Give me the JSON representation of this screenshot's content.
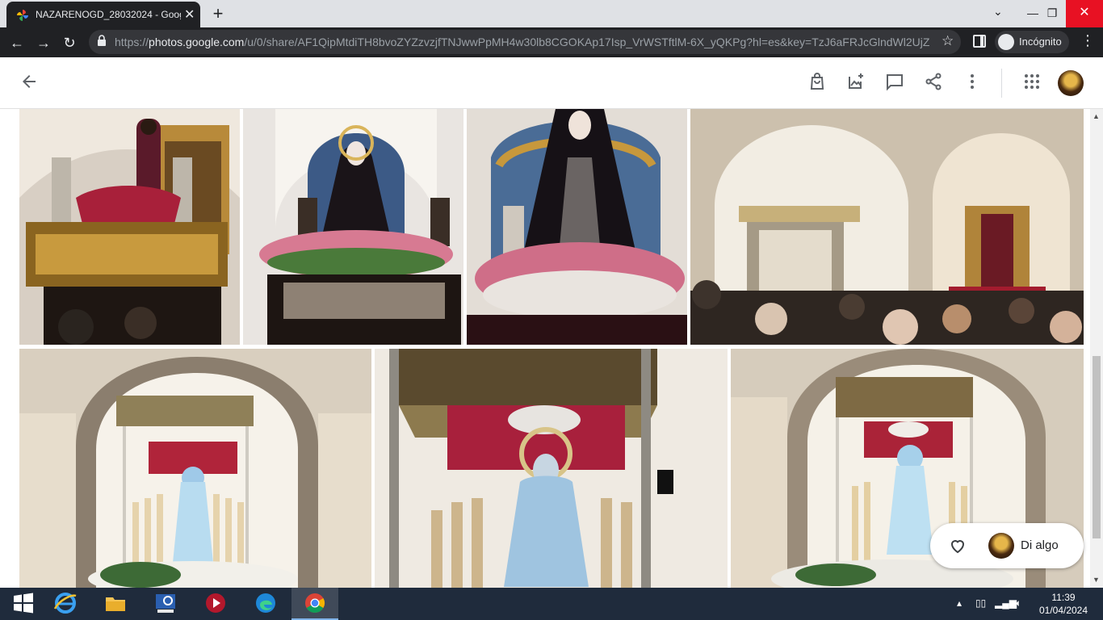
{
  "browser": {
    "tab_title": "NAZARENOGD_28032024 - Google Fotos",
    "url_prefix": "https://",
    "url_host": "photos.google.com",
    "url_path": "/u/0/share/AF1QipMtdiTH8bvoZYZzvzjfTNJwwPpMH4w30lb8CGOKAp17Isp_VrWSTftlM-6X_yQKPg?hl=es&key=TzJ6aFRJcGlndWl2UjZ6S...",
    "profile_label": "Incógnito"
  },
  "photos": [
    {
      "kind": "nazareno-paso"
    },
    {
      "kind": "virgin-altar-1"
    },
    {
      "kind": "virgin-altar-2"
    },
    {
      "kind": "church-procession"
    },
    {
      "kind": "palio-arch-1"
    },
    {
      "kind": "palio-closeup"
    },
    {
      "kind": "palio-arch-2"
    }
  ],
  "comment": {
    "placeholder": "Di algo"
  },
  "taskbar": {
    "time": "11:39",
    "date": "01/04/2024"
  },
  "colors": {
    "chrome_dark": "#202124",
    "accent_close": "#e81123",
    "taskbar": "#1f2b3c"
  }
}
